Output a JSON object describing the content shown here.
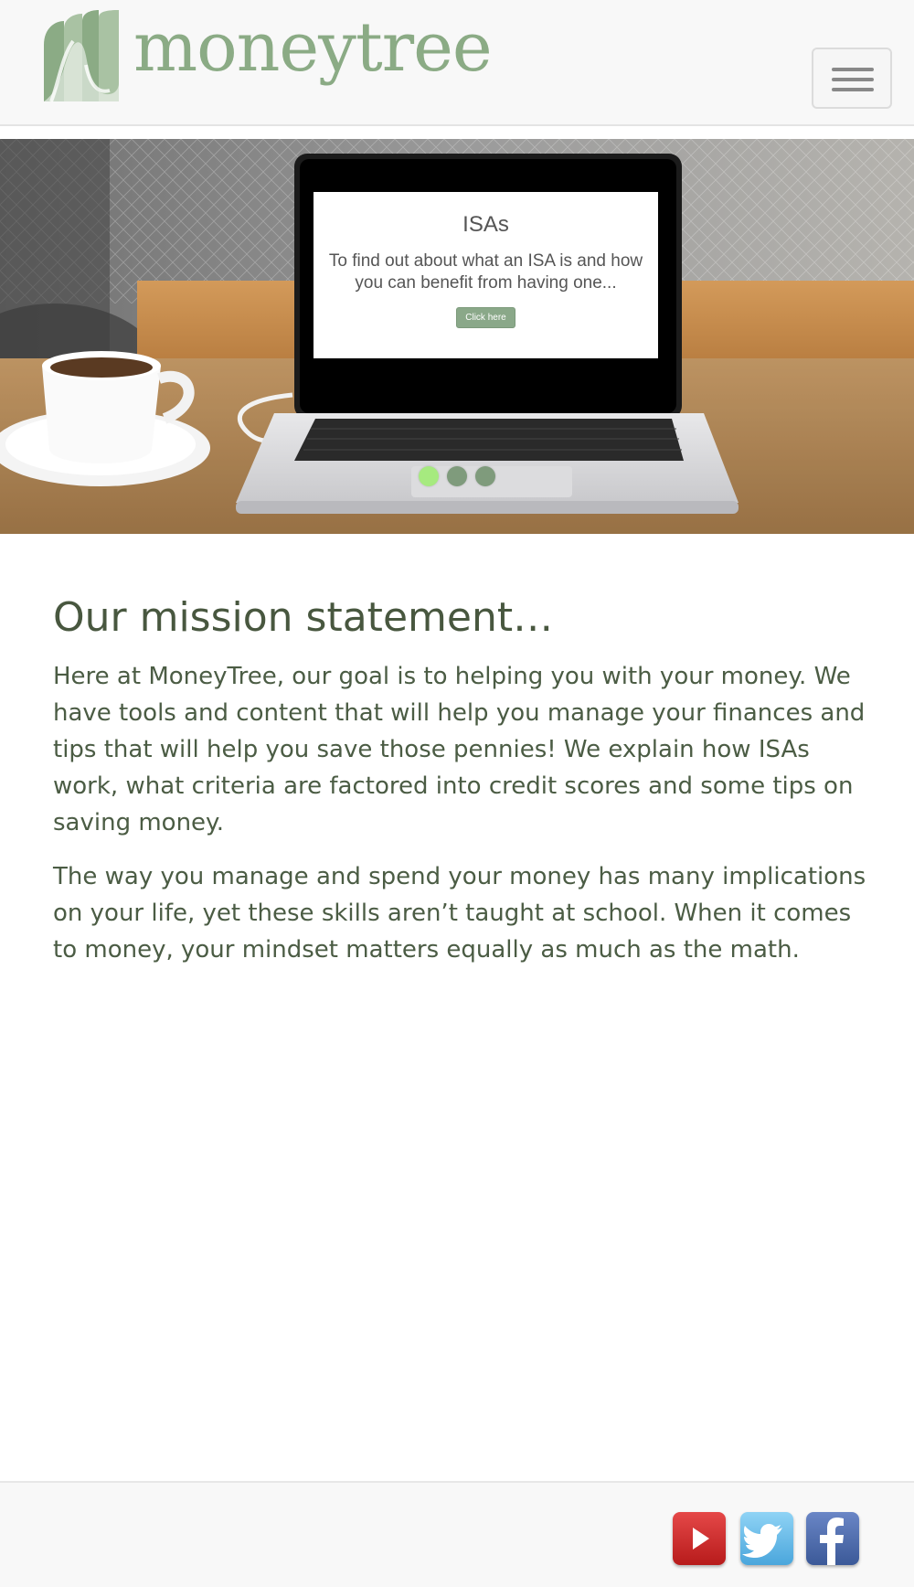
{
  "brand": {
    "logo_text": "moneytree",
    "logo_color": "#8bab85"
  },
  "navbar": {
    "menu_icon": "hamburger-menu-icon"
  },
  "carousel": {
    "slide": {
      "title": "ISAs",
      "text": "To find out about what an ISA is and how you can benefit from having one...",
      "button_label": "Click here"
    },
    "indicators": [
      {
        "active": true
      },
      {
        "active": false
      },
      {
        "active": false
      }
    ],
    "active_color": "#a6ea7f",
    "inactive_color": "#7f9b7c"
  },
  "mission": {
    "heading": "Our mission statement…",
    "paragraphs": [
      "Here at MoneyTree, our goal is to helping you with your money. We have tools and content that will help you manage your finances and tips that will help you save those pennies! We explain how ISAs work, what criteria are factored into credit scores and some tips on saving money.",
      "The way you manage and spend your money has many implications on your life, yet these skills aren’t taught at school. When it comes to money, your mindset matters equally as much as the math."
    ]
  },
  "footer": {
    "social": [
      {
        "name": "youtube-icon",
        "color": "#cf2a2a"
      },
      {
        "name": "twitter-icon",
        "color": "#5fb8e6"
      },
      {
        "name": "facebook-icon",
        "color": "#3b5998"
      }
    ]
  }
}
